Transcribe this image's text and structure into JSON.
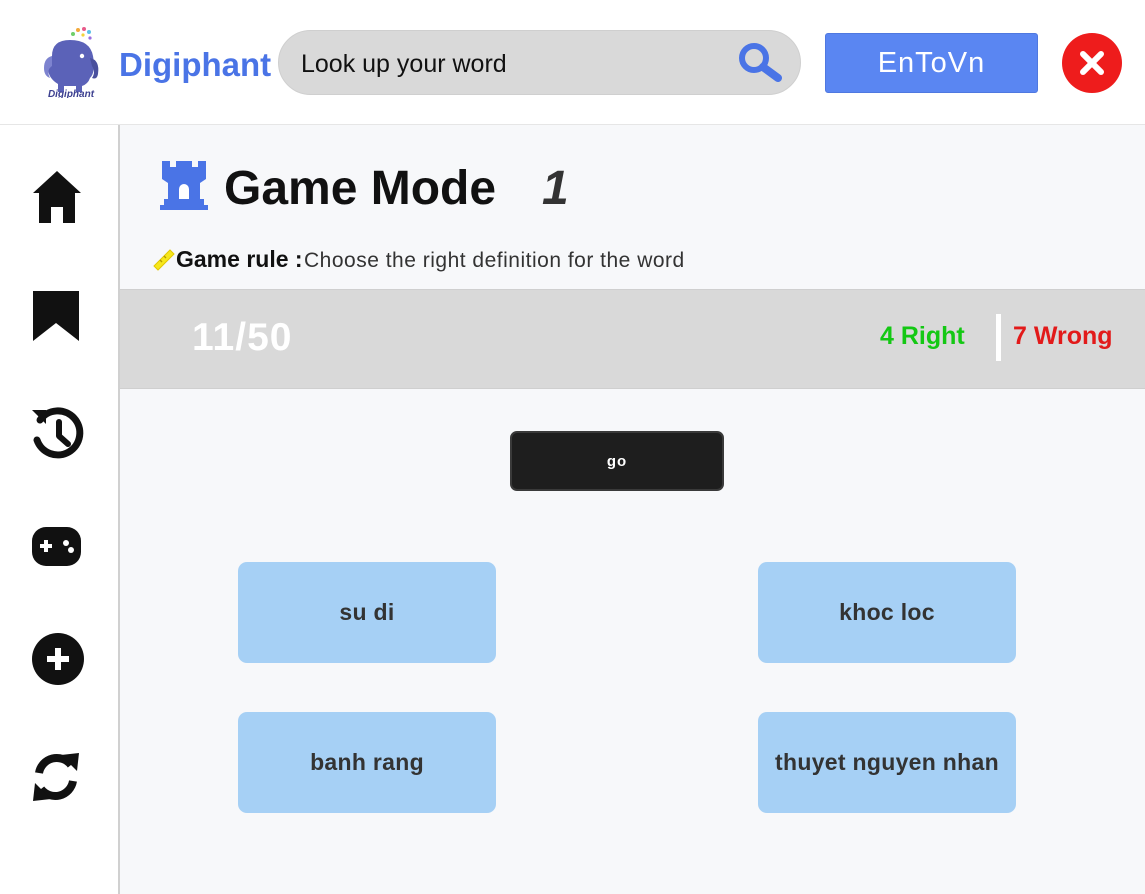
{
  "header": {
    "brand": "Digiphant",
    "logo_text": "Digiphant",
    "search": {
      "placeholder": "Look up your word",
      "value": ""
    },
    "lang_button": "EnToVn",
    "close_icon": "close-icon",
    "search_icon": "search-icon"
  },
  "sidebar": {
    "items": [
      {
        "icon": "home-icon"
      },
      {
        "icon": "bookmark-icon"
      },
      {
        "icon": "history-icon"
      },
      {
        "icon": "gamepad-icon"
      },
      {
        "icon": "add-circle-icon"
      },
      {
        "icon": "refresh-icon"
      }
    ]
  },
  "game": {
    "title": "Game Mode",
    "level": "1",
    "rule_label": "Game rule :",
    "rule_text": "Choose the right definition for the word",
    "progress": "11/50",
    "right": "4 Right",
    "wrong": "7 Wrong",
    "word": "go",
    "options": [
      "su di",
      "khoc loc",
      "banh rang",
      "thuyet nguyen nhan"
    ]
  },
  "colors": {
    "brand": "#4a74e6",
    "lang_button": "#5a86f2",
    "close": "#ee1c1c",
    "right": "#14c814",
    "wrong": "#e21a1a",
    "option_bg": "#a6d0f5",
    "word_bg": "#1e1e1e"
  }
}
